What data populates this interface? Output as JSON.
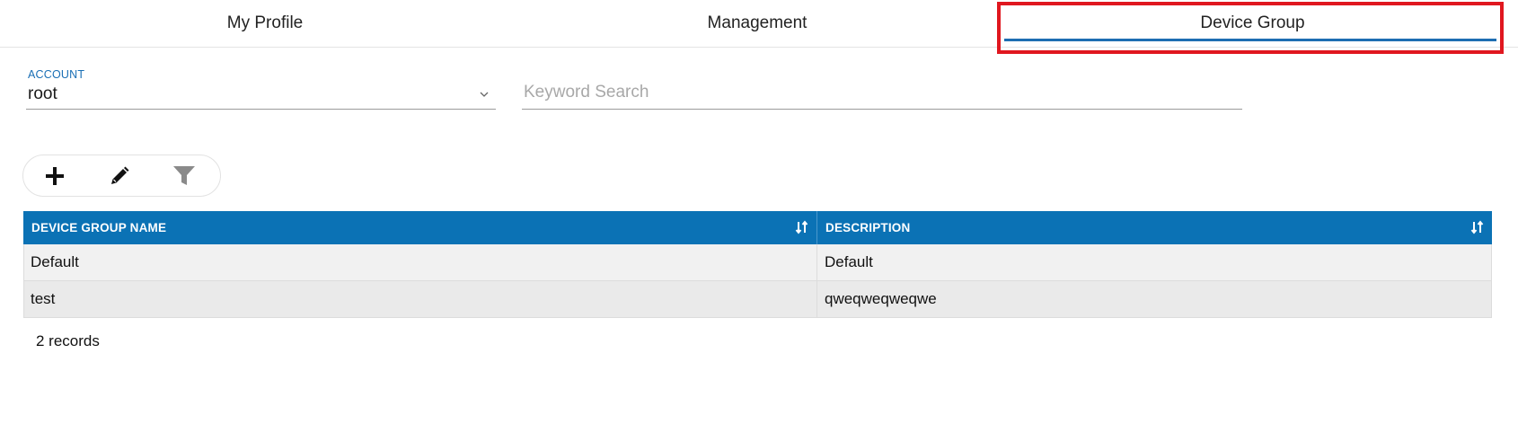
{
  "tabs": [
    {
      "label": "My Profile"
    },
    {
      "label": "Management"
    },
    {
      "label": "Device Group",
      "active": true
    }
  ],
  "filters": {
    "account": {
      "label": "ACCOUNT",
      "value": "root"
    },
    "search": {
      "placeholder": "Keyword Search",
      "value": ""
    }
  },
  "toolbar": {
    "icons": [
      "plus-icon",
      "pencil-icon",
      "filter-icon"
    ]
  },
  "table": {
    "columns": [
      "DEVICE GROUP NAME",
      "DESCRIPTION"
    ],
    "rows": [
      [
        "Default",
        "Default"
      ],
      [
        "test",
        "qweqweqweqwe"
      ]
    ],
    "footer": "2 records"
  },
  "colors": {
    "accent": "#1e6eb2",
    "header_bg": "#0b72b5",
    "highlight": "#e0171f"
  }
}
